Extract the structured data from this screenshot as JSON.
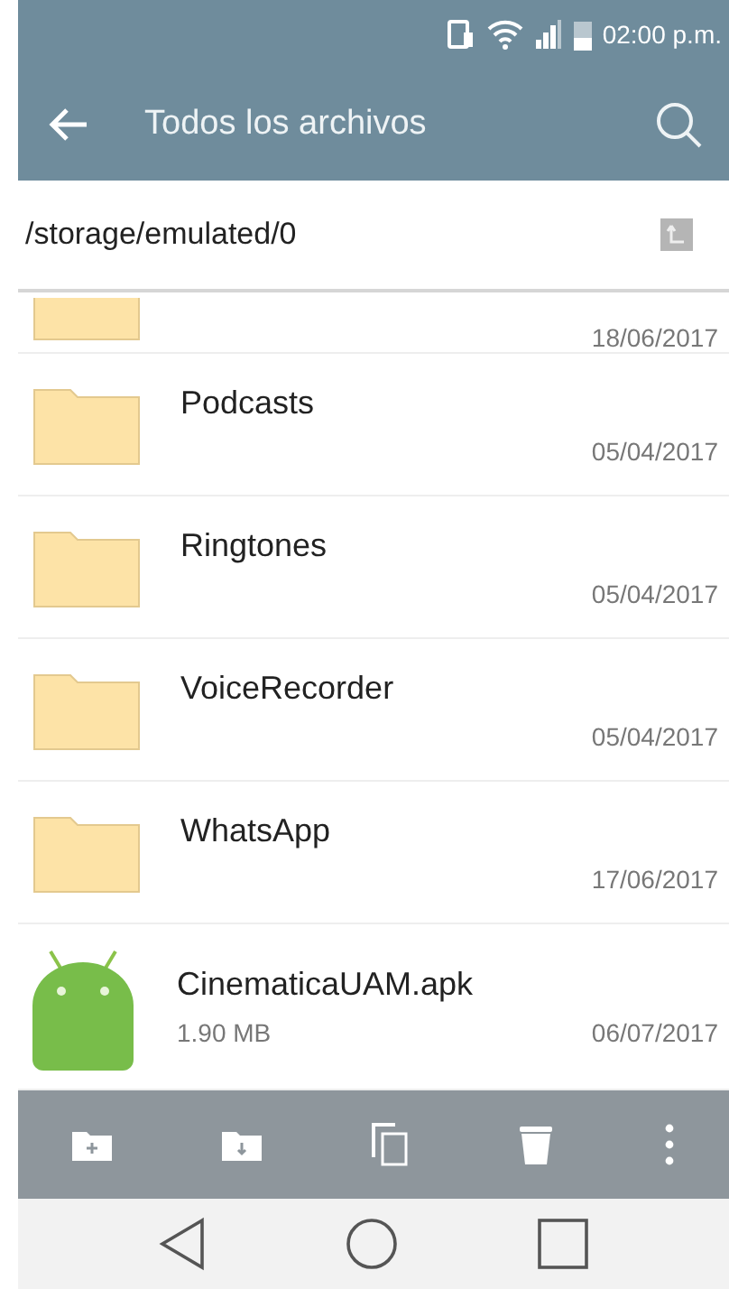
{
  "status_bar": {
    "time": "02:00 p.m."
  },
  "app_bar": {
    "title": "Todos los archivos"
  },
  "path_bar": {
    "path": "/storage/emulated/0"
  },
  "files": [
    {
      "kind": "folder",
      "date": "18/06/2017",
      "partial": true
    },
    {
      "kind": "folder",
      "name": "Podcasts",
      "date": "05/04/2017"
    },
    {
      "kind": "folder",
      "name": "Ringtones",
      "date": "05/04/2017"
    },
    {
      "kind": "folder",
      "name": "VoiceRecorder",
      "date": "05/04/2017"
    },
    {
      "kind": "folder",
      "name": "WhatsApp",
      "date": "17/06/2017"
    },
    {
      "kind": "apk",
      "name": "CinematicaUAM.apk",
      "size": "1.90 MB",
      "date": "06/07/2017"
    }
  ]
}
